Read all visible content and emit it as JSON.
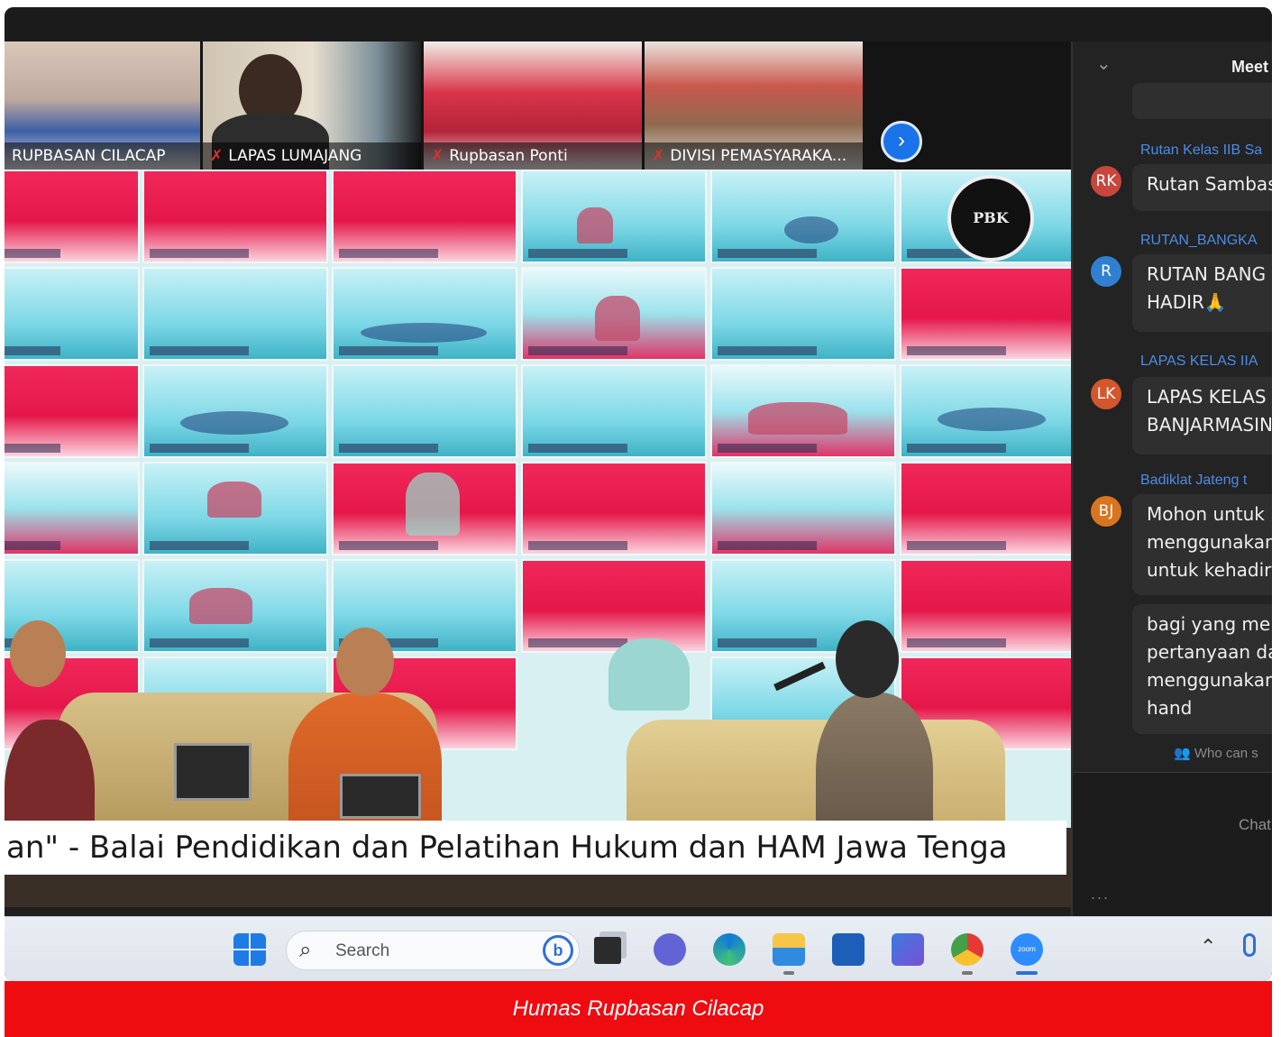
{
  "participants": [
    {
      "name": "RUPBASAN CILACAP",
      "muted": false
    },
    {
      "name": "LAPAS LUMAJANG",
      "muted": true
    },
    {
      "name": "Rupbasan Ponti",
      "muted": true
    },
    {
      "name": "DIVISI PEMASYARAKA...",
      "muted": true
    }
  ],
  "next_icon": "chevron-right-icon",
  "main_video": {
    "ticker": "an\" - Balai Pendidikan dan Pelatihan Hukum dan HAM Jawa Tenga",
    "seal_text": "PBK"
  },
  "chat": {
    "title": "Meet",
    "messages": [
      {
        "sender": "Rutan Kelas IIB Sa",
        "initials": "RK",
        "avatar_color": "#c9463d",
        "lines": [
          "Rutan Sambas"
        ]
      },
      {
        "sender": "RUTAN_BANGKA",
        "initials": "R",
        "avatar_color": "#2f80d1",
        "lines": [
          "RUTAN BANG",
          "HADIR🙏"
        ]
      },
      {
        "sender": "LAPAS KELAS IIA",
        "initials": "LK",
        "avatar_color": "#d4562c",
        "lines": [
          "LAPAS KELAS",
          "BANJARMASIN"
        ]
      },
      {
        "sender": "Badiklat Jateng t",
        "initials": "BJ",
        "avatar_color": "#d9741f",
        "lines": [
          "Mohon untuk",
          "menggunakan",
          "untuk kehadir"
        ]
      },
      {
        "sender": "",
        "initials": "",
        "avatar_color": "",
        "lines": [
          "bagi yang me",
          "pertanyaan da",
          "menggunakan",
          "hand"
        ]
      }
    ],
    "who_can_see": "Who can s",
    "input_placeholder": "Chat",
    "more": "..."
  },
  "taskbar": {
    "search_placeholder": "Search",
    "bing_glyph": "b",
    "apps": [
      "task-view-icon",
      "chat-icon",
      "edge-icon",
      "file-explorer-icon",
      "store-icon",
      "app-icon",
      "chrome-icon",
      "zoom-icon"
    ],
    "zoom_label": "zoom"
  },
  "caption": "Humas Rupbasan Cilacap",
  "colors": {
    "caption_bg": "#ee0c11",
    "accent_blue": "#1a73e8",
    "chat_bg": "#232323"
  }
}
